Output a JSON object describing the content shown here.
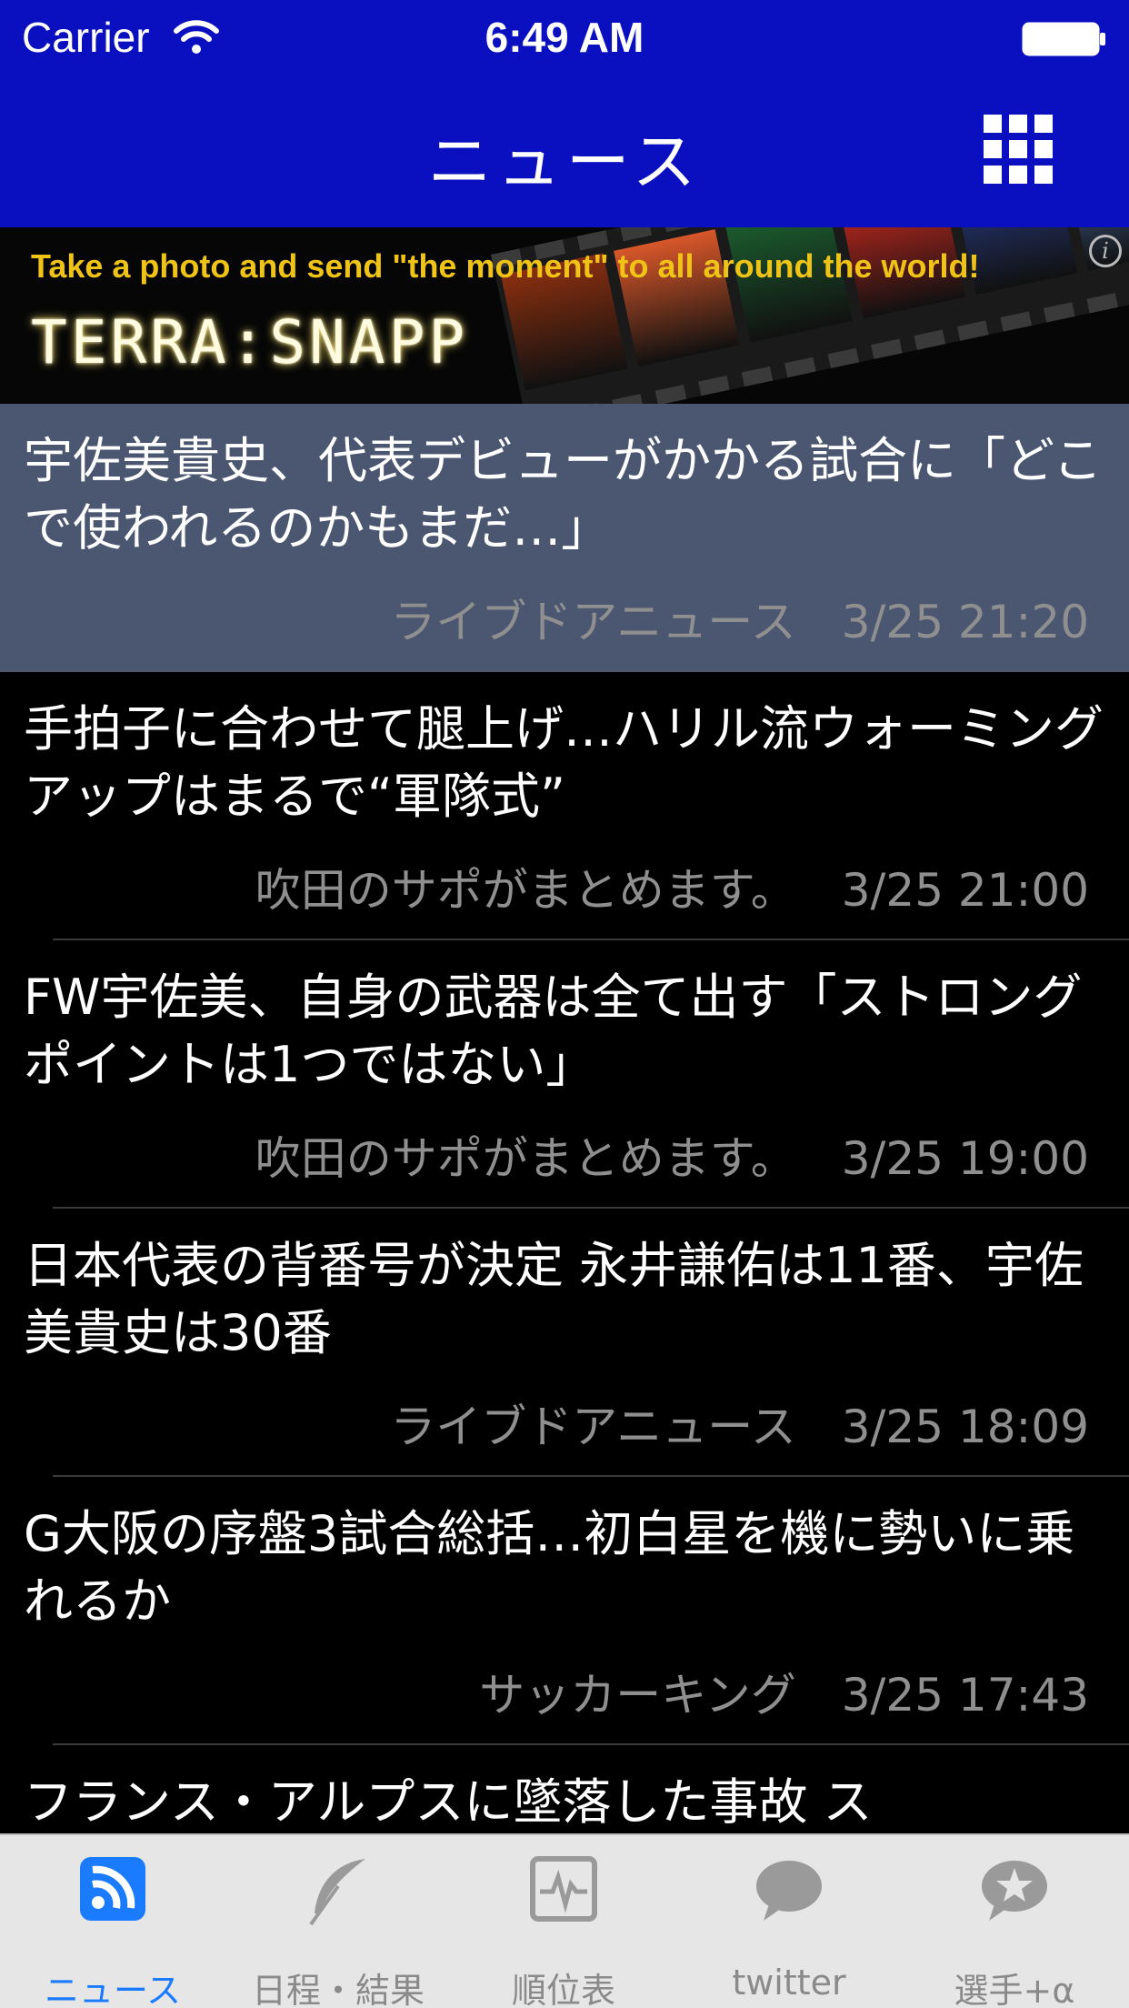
{
  "status_bar": {
    "carrier": "Carrier",
    "time": "6:49 AM"
  },
  "nav": {
    "title": "ニュース",
    "menu_icon": "grid-icon"
  },
  "ad": {
    "tagline": "Take a photo and send  \"the moment\" to all around the world!",
    "logo": "TERRA:SNAPP",
    "info_glyph": "i",
    "frame_colors": [
      "#8a2f10",
      "#d8572a",
      "#1b5b2e",
      "#c4281f",
      "#2a3e8a",
      "#4e6fa8"
    ]
  },
  "news": [
    {
      "title": "宇佐美貴史、代表デビューがかかる試合に「どこで使われるのかもまだ…」",
      "source": "ライブドアニュース",
      "time": "3/25 21:20",
      "selected": true
    },
    {
      "title": "手拍子に合わせて腿上げ…ハリル流ウォーミングアップはまるで“軍隊式”",
      "source": "吹田のサポがまとめます。",
      "time": "3/25 21:00"
    },
    {
      "title": "FW宇佐美、自身の武器は全て出す「ストロングポイントは1つではない」",
      "source": "吹田のサポがまとめます。",
      "time": "3/25 19:00"
    },
    {
      "title": "日本代表の背番号が決定 永井謙佑は11番、宇佐美貴史は30番",
      "source": "ライブドアニュース",
      "time": "3/25 18:09"
    },
    {
      "title": "G大阪の序盤3試合総括…初白星を機に勢いに乗れるか",
      "source": "サッカーキング",
      "time": "3/25 17:43"
    },
    {
      "title": "フランス・アルプスに墜落した事故 ス",
      "source": "",
      "time": ""
    }
  ],
  "tabs": [
    {
      "label": "ニュース",
      "icon": "rss-icon",
      "active": true
    },
    {
      "label": "日程・結果",
      "icon": "feather-icon"
    },
    {
      "label": "順位表",
      "icon": "chart-icon"
    },
    {
      "label": "twitter",
      "icon": "speech-bubble-icon"
    },
    {
      "label": "選手+α",
      "icon": "star-bubble-icon"
    }
  ],
  "colors": {
    "bar": "#0a0fbf",
    "selected_row": "#4b5671",
    "accent": "#1a7bff",
    "tab_inactive": "#8a8a8a"
  }
}
